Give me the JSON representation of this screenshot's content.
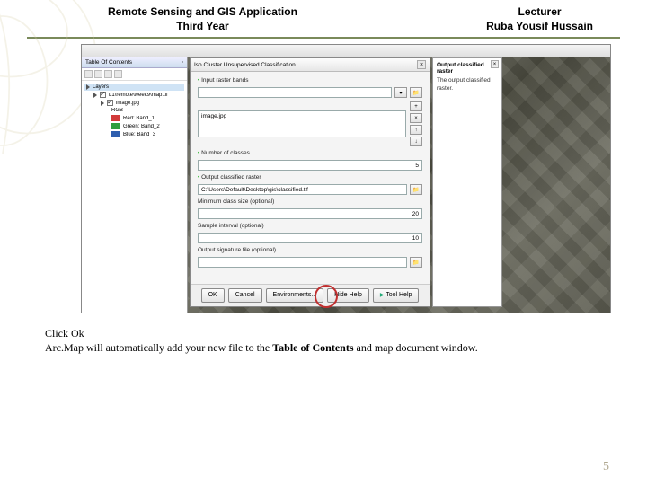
{
  "header": {
    "left_line1": "Remote Sensing and GIS Application",
    "left_line2": "Third Year",
    "right_line1": "Lecturer",
    "right_line2": "Ruba Yousif Hussain"
  },
  "toc": {
    "title": "Table Of Contents",
    "layers_label": "Layers",
    "image_group": "L1\\remote\\week9\\map.tif",
    "image_item": "image.jpg",
    "rgb_label": "RGB",
    "bands": [
      {
        "label": "Red: Band_1",
        "color": "#d23a3a"
      },
      {
        "label": "Green: Band_2",
        "color": "#2e9e3e"
      },
      {
        "label": "Blue: Band_3",
        "color": "#2e5eae"
      }
    ]
  },
  "dialog": {
    "title": "Iso Cluster Unsupervised Classification",
    "input_bands_label": "Input raster bands",
    "input_bands_value": "image.jpg",
    "num_classes_label": "Number of classes",
    "num_classes_value": "5",
    "output_raster_label": "Output classified raster",
    "output_raster_value": "C:\\Users\\Default\\Desktop\\gis\\classified.tif",
    "min_class_label": "Minimum class size (optional)",
    "min_class_value": "20",
    "sample_interval_label": "Sample interval (optional)",
    "sample_interval_value": "10",
    "out_sig_label": "Output signature file (optional)",
    "out_sig_value": "",
    "buttons": {
      "ok": "OK",
      "cancel": "Cancel",
      "env": "Environments...",
      "hide_help": "Hide Help",
      "tool_help": "Tool Help"
    }
  },
  "sidepanel": {
    "title": "Output classified raster",
    "text": "The output classified raster."
  },
  "body": {
    "line1": "Click Ok",
    "line2a": "Arc.Map will automatically add your new file to the ",
    "line2b": "Table of Contents",
    "line2c": " and map document window."
  },
  "page_number": "5"
}
